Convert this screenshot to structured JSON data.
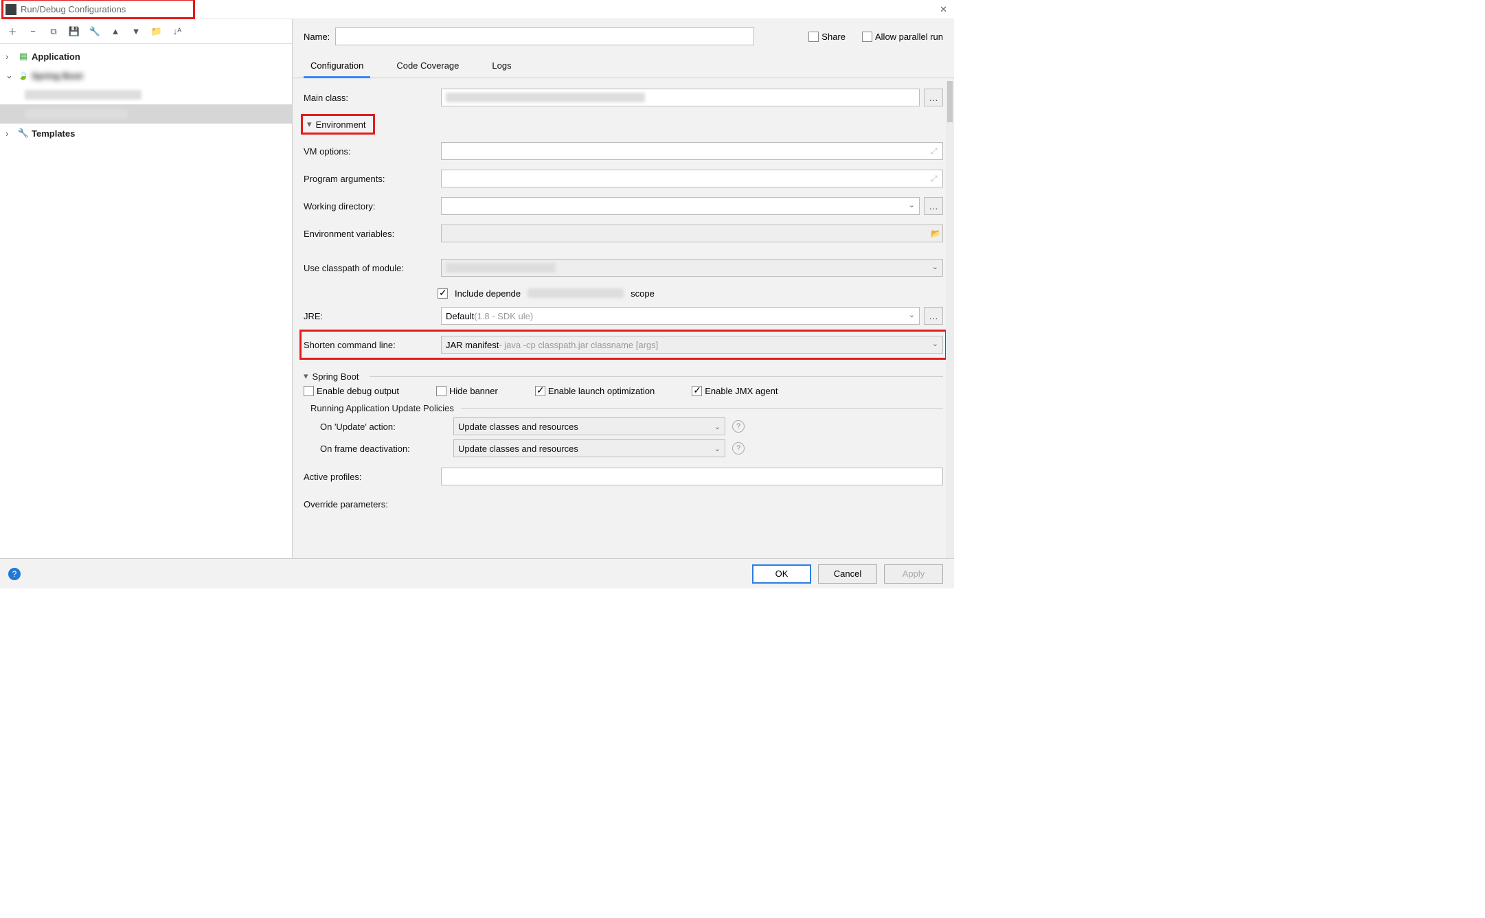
{
  "title": "Run/Debug Configurations",
  "toolbar_icons": [
    "+",
    "−",
    "⧉",
    "💾",
    "🔧",
    "▲",
    "▼",
    "📁",
    "↓ᴬ"
  ],
  "tree": {
    "application_label": "Application",
    "spring_boot_label": "Spring Boot",
    "templates_label": "Templates"
  },
  "name_row": {
    "label": "Name:",
    "value": "",
    "share_label": "Share",
    "allow_parallel_label": "Allow parallel run"
  },
  "tabs": {
    "configuration": "Configuration",
    "code_coverage": "Code Coverage",
    "logs": "Logs"
  },
  "form": {
    "main_class_label": "Main class:",
    "environment_label": "Environment",
    "vm_options_label": "VM options:",
    "program_arguments_label": "Program arguments:",
    "working_directory_label": "Working directory:",
    "env_vars_label": "Environment variables:",
    "classpath_label": "Use classpath of module:",
    "include_deps_label": "Include dependencies with \"Provided\" scope",
    "include_deps_prefix": "Include depende",
    "include_deps_suffix": "scope",
    "jre_label": "JRE:",
    "jre_value": "Default ",
    "jre_hint": "(1.8 - SDK                                       ule)",
    "shorten_label": "Shorten command line:",
    "shorten_value": "JAR manifest ",
    "shorten_hint": "- java -cp classpath.jar classname [args]",
    "spring_boot_section": "Spring Boot",
    "enable_debug_label": "Enable debug output",
    "hide_banner_label": "Hide banner",
    "enable_launch_opt_label": "Enable launch optimization",
    "enable_jmx_label": "Enable JMX agent",
    "update_policies_head": "Running Application Update Policies",
    "on_update_label": "On 'Update' action:",
    "on_update_value": "Update classes and resources",
    "on_frame_label": "On frame deactivation:",
    "on_frame_value": "Update classes and resources",
    "active_profiles_label": "Active profiles:",
    "override_params_label": "Override parameters:"
  },
  "footer": {
    "ok": "OK",
    "cancel": "Cancel",
    "apply": "Apply"
  }
}
